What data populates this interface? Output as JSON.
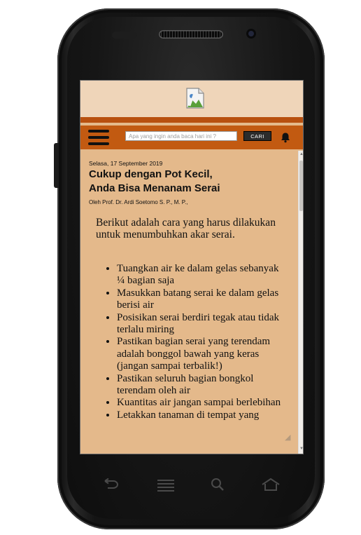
{
  "article": {
    "date": "Selasa, 17 September 2019",
    "title_line1": "Cukup dengan Pot Kecil,",
    "title_line2": "Anda Bisa Menanam Serai",
    "author": "Oleh Prof. Dr. Ardi Soetomo S. P., M. P.,",
    "intro": "Berikut adalah cara yang harus dilakukan untuk menumbuhkan akar serai.",
    "steps": [
      "Tuangkan air ke dalam gelas sebanyak ¼ bagian saja",
      "Masukkan batang serai ke dalam gelas berisi air",
      "Posisikan serai berdiri tegak atau tidak terlalu miring",
      "Pastikan bagian serai yang terendam adalah bonggol bawah yang keras (jangan sampai terbalik!)",
      "Pastikan seluruh bagian bongkol terendam oleh air",
      "Kuantitas air jangan sampai berlebihan",
      "Letakkan tanaman di tempat yang"
    ]
  },
  "header": {
    "search_placeholder": "Apa yang ingin anda baca hari ini ?",
    "search_button": "CARI"
  },
  "colors": {
    "page_background": "#e4b98b",
    "banner": "#efd5b9",
    "navbar": "#c25a11",
    "stripe": "#b8500f"
  },
  "icons": {
    "menu": "hamburger-icon",
    "notifications": "bell-icon",
    "banner": "broken-image-icon",
    "device_keys": [
      "back-icon",
      "menu-icon",
      "search-icon",
      "home-icon"
    ]
  }
}
